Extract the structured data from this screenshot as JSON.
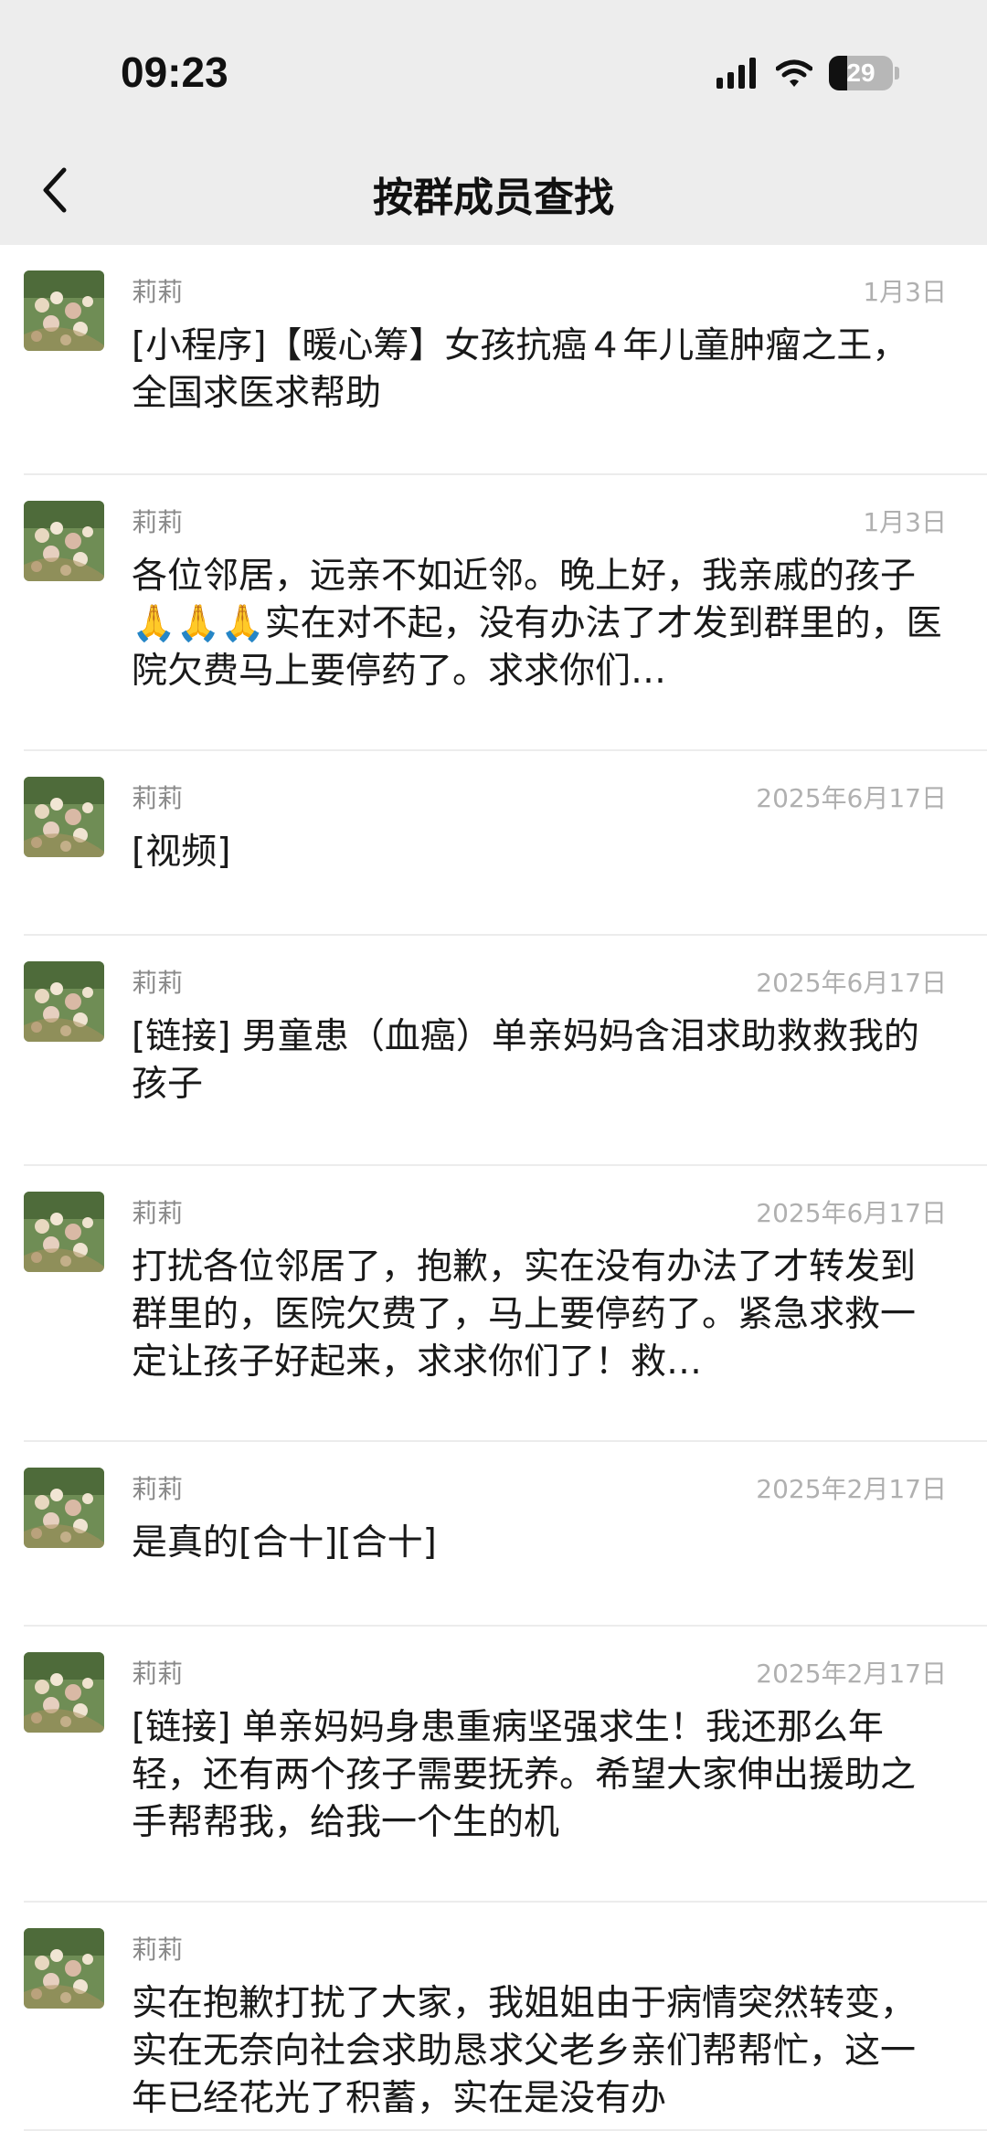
{
  "status": {
    "time": "09:23",
    "battery": "29",
    "battery_level": 0.29
  },
  "header": {
    "title": "按群成员查找"
  },
  "messages": [
    {
      "name": "莉莉",
      "date": "1月3日",
      "text": "[小程序]【暖心筹】女孩抗癌４年儿童肿瘤之王，全国求医求帮助"
    },
    {
      "name": "莉莉",
      "date": "1月3日",
      "text": "各位邻居，远亲不如近邻。晚上好，我亲戚的孩子🙏🙏🙏实在对不起，没有办法了才发到群里的，医院欠费马上要停药了。求求你们…"
    },
    {
      "name": "莉莉",
      "date": "2025年6月17日",
      "text": "[视频]"
    },
    {
      "name": "莉莉",
      "date": "2025年6月17日",
      "text": "[链接] 男童患（血癌）单亲妈妈含泪求助救救我的孩子"
    },
    {
      "name": "莉莉",
      "date": "2025年6月17日",
      "text": "打扰各位邻居了，抱歉，实在没有办法了才转发到群里的，医院欠费了，马上要停药了。紧急求救一定让孩子好起来，求求你们了！救…"
    },
    {
      "name": "莉莉",
      "date": "2025年2月17日",
      "text": "是真的[合十][合十]"
    },
    {
      "name": "莉莉",
      "date": "2025年2月17日",
      "text": "[链接] 单亲妈妈身患重病坚强求生！我还那么年轻，还有两个孩子需要抚养。希望大家伸出援助之手帮帮我，给我一个生的机"
    },
    {
      "name": "莉莉",
      "date": "",
      "text": "实在抱歉打扰了大家，我姐姐由于病情突然转变，实在无奈向社会求助恳求父老乡亲们帮帮忙，这一年已经花光了积蓄，实在是没有办"
    }
  ]
}
